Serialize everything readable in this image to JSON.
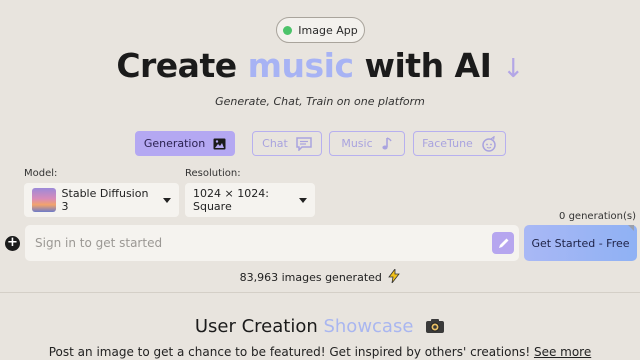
{
  "badge": {
    "label": "Image App",
    "status_color": "#4cc36a"
  },
  "hero": {
    "prefix": "Create ",
    "highlight": "music",
    "suffix": " with AI",
    "arrow": "↓"
  },
  "subtitle": "Generate, Chat, Train on one platform",
  "modes": [
    {
      "label": "Generation",
      "icon": "image-icon",
      "active": true
    },
    {
      "label": "Chat",
      "icon": "chat-icon",
      "active": false
    },
    {
      "label": "Music",
      "icon": "music-note-icon",
      "active": false
    },
    {
      "label": "FaceTune",
      "icon": "face-icon",
      "active": false
    }
  ],
  "model": {
    "label": "Model:",
    "value": "Stable Diffusion 3"
  },
  "resolution": {
    "label": "Resolution:",
    "value": "1024 × 1024: Square"
  },
  "generation_count": "0 generation(s)",
  "prompt": {
    "placeholder": "Sign in to get started",
    "value": ""
  },
  "start_button": "Get Started - Free",
  "stats": {
    "text": "83,963 images generated"
  },
  "showcase": {
    "title_prefix": "User Creation ",
    "title_highlight": "Showcase",
    "subtitle": "Post an image to get a chance to be featured! Get inspired by others' creations! ",
    "link": "See more"
  },
  "colors": {
    "accent": "#b4a8f2",
    "highlight": "#a7b3f4",
    "background": "#e8e4de"
  }
}
